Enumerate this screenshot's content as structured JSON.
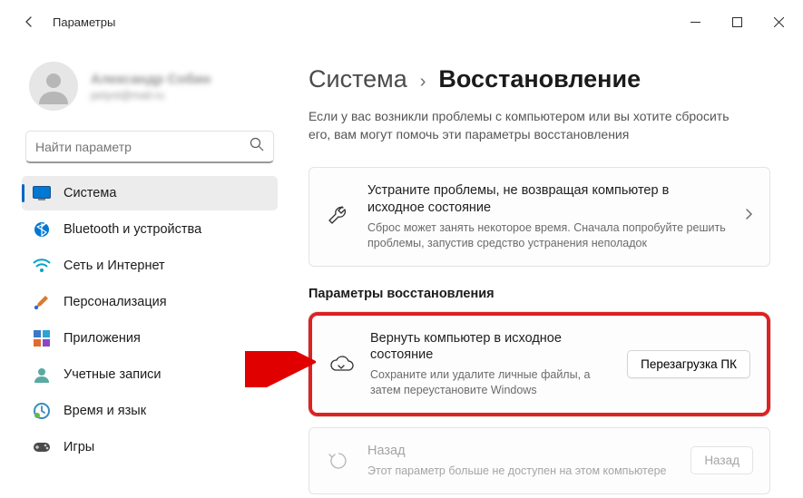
{
  "titlebar": {
    "title": "Параметры"
  },
  "profile": {
    "name": "Александр Собин",
    "email": "petyot@mail.ru"
  },
  "search": {
    "placeholder": "Найти параметр"
  },
  "sidebar": {
    "items": [
      {
        "label": "Система"
      },
      {
        "label": "Bluetooth и устройства"
      },
      {
        "label": "Сеть и Интернет"
      },
      {
        "label": "Персонализация"
      },
      {
        "label": "Приложения"
      },
      {
        "label": "Учетные записи"
      },
      {
        "label": "Время и язык"
      },
      {
        "label": "Игры"
      }
    ]
  },
  "breadcrumb": {
    "parent": "Система",
    "current": "Восстановление"
  },
  "intro": "Если у вас возникли проблемы с компьютером или вы хотите сбросить его, вам могут помочь эти параметры восстановления",
  "troubleshoot_card": {
    "title": "Устраните проблемы, не возвращая компьютер в исходное состояние",
    "desc": "Сброс может занять некоторое время. Сначала попробуйте решить проблемы, запустив средство устранения неполадок"
  },
  "section_title": "Параметры восстановления",
  "reset_card": {
    "title": "Вернуть компьютер в исходное состояние",
    "desc": "Сохраните или удалите личные файлы, а затем переустановите Windows",
    "button": "Перезагрузка ПК"
  },
  "back_card": {
    "title": "Назад",
    "desc": "Этот параметр больше не доступен на этом компьютере",
    "button": "Назад"
  }
}
